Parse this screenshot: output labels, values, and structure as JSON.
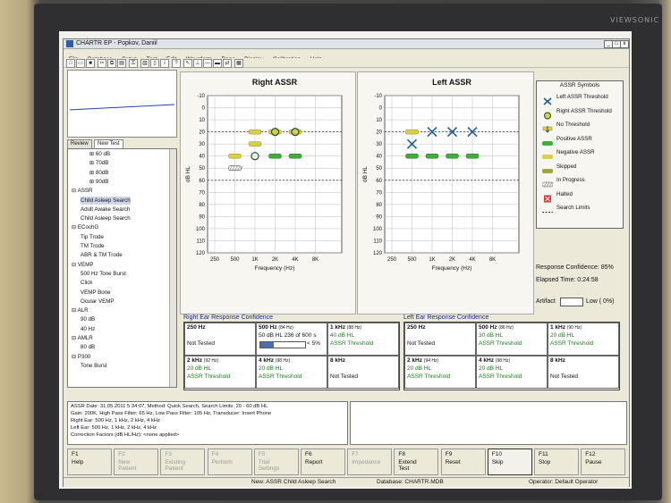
{
  "monitor": {
    "brand": "VIEWSONIC"
  },
  "window": {
    "title": "CHARTR EP - Popkov, Daniil",
    "buttons": [
      "_",
      "□",
      "x"
    ]
  },
  "menu": [
    "File",
    "Database",
    "Setup",
    "Test",
    "Edit",
    "Waveform",
    "Page",
    "Display",
    "Calibration",
    "Help"
  ],
  "left_panel": {
    "tabs": [
      "Review",
      "New Test"
    ],
    "tree": [
      {
        "label": "60 dB",
        "indent": 2,
        "expander": "+"
      },
      {
        "label": "70dB",
        "indent": 2,
        "expander": "+"
      },
      {
        "label": "80dB",
        "indent": 2,
        "expander": "+"
      },
      {
        "label": "90dB",
        "indent": 2,
        "expander": "+"
      },
      {
        "label": "ASSR",
        "indent": 0,
        "expander": "-"
      },
      {
        "label": "Child Asleep Search",
        "indent": 1,
        "expander": "",
        "selected": true
      },
      {
        "label": "Adult Awake Search",
        "indent": 1,
        "expander": ""
      },
      {
        "label": "Child Asleep Search",
        "indent": 1,
        "expander": ""
      },
      {
        "label": "ECochG",
        "indent": 0,
        "expander": "-"
      },
      {
        "label": "Tip Trode",
        "indent": 1,
        "expander": ""
      },
      {
        "label": "TM Trode",
        "indent": 1,
        "expander": ""
      },
      {
        "label": "ABR & TM Trode",
        "indent": 1,
        "expander": ""
      },
      {
        "label": "VEMP",
        "indent": 0,
        "expander": "-"
      },
      {
        "label": "500 Hz Tone Burst",
        "indent": 1,
        "expander": ""
      },
      {
        "label": "Click",
        "indent": 1,
        "expander": ""
      },
      {
        "label": "VEMP Bone",
        "indent": 1,
        "expander": ""
      },
      {
        "label": "Ocular VEMP",
        "indent": 1,
        "expander": ""
      },
      {
        "label": "ALR",
        "indent": 0,
        "expander": "-"
      },
      {
        "label": "90 dB",
        "indent": 1,
        "expander": ""
      },
      {
        "label": "40 Hz",
        "indent": 1,
        "expander": ""
      },
      {
        "label": "AMLR",
        "indent": 0,
        "expander": "-"
      },
      {
        "label": "80 dB",
        "indent": 1,
        "expander": ""
      },
      {
        "label": "P300",
        "indent": 0,
        "expander": "-"
      },
      {
        "label": "Tone Burst",
        "indent": 1,
        "expander": ""
      }
    ]
  },
  "chart_data": [
    {
      "type": "scatter",
      "title": "Right ASSR",
      "xlabel": "Frequency (Hz)",
      "ylabel": "dB HL",
      "x_ticks": [
        "250",
        "500",
        "1K",
        "2K",
        "4K",
        "8K"
      ],
      "y_ticks": [
        -10,
        0,
        10,
        20,
        30,
        40,
        50,
        60,
        70,
        80,
        90,
        100,
        110,
        120
      ],
      "ylim": [
        -10,
        120
      ],
      "search_limits": [
        20,
        60
      ],
      "series": [
        {
          "name": "Right ASSR Threshold",
          "points": [
            {
              "x": "1K",
              "y": 40
            },
            {
              "x": "2K",
              "y": 20
            },
            {
              "x": "4K",
              "y": 20
            }
          ]
        },
        {
          "name": "Positive ASSR",
          "points": [
            {
              "x": "2K",
              "y": 40
            },
            {
              "x": "4K",
              "y": 40
            }
          ]
        },
        {
          "name": "Negative ASSR",
          "points": [
            {
              "x": "500",
              "y": 40
            },
            {
              "x": "1K",
              "y": 20
            },
            {
              "x": "1K",
              "y": 30
            },
            {
              "x": "2K",
              "y": 20
            },
            {
              "x": "4K",
              "y": 20
            }
          ]
        },
        {
          "name": "In Progress",
          "points": [
            {
              "x": "500",
              "y": 50
            }
          ]
        }
      ]
    },
    {
      "type": "scatter",
      "title": "Left ASSR",
      "xlabel": "Frequency (Hz)",
      "ylabel": "dB HL",
      "x_ticks": [
        "250",
        "500",
        "1K",
        "2K",
        "4K",
        "8K"
      ],
      "y_ticks": [
        -10,
        0,
        10,
        20,
        30,
        40,
        50,
        60,
        70,
        80,
        90,
        100,
        110,
        120
      ],
      "ylim": [
        -10,
        120
      ],
      "search_limits": [
        20,
        60
      ],
      "series": [
        {
          "name": "Left ASSR Threshold",
          "points": [
            {
              "x": "500",
              "y": 30
            },
            {
              "x": "1K",
              "y": 20
            },
            {
              "x": "2K",
              "y": 20
            },
            {
              "x": "4K",
              "y": 20
            }
          ]
        },
        {
          "name": "Positive ASSR",
          "points": [
            {
              "x": "500",
              "y": 40
            },
            {
              "x": "1K",
              "y": 40
            },
            {
              "x": "2K",
              "y": 40
            },
            {
              "x": "4K",
              "y": 40
            }
          ]
        },
        {
          "name": "Negative ASSR",
          "points": [
            {
              "x": "500",
              "y": 20
            }
          ]
        }
      ]
    }
  ],
  "legend": {
    "title": "ASSR Symbols",
    "items": [
      {
        "label": "Left ASSR Threshold",
        "symbol": "x-icon"
      },
      {
        "label": "Right ASSR Threshold",
        "symbol": "circle-icon"
      },
      {
        "label": "No Threshold",
        "symbol": "arrow-icon"
      },
      {
        "label": "Positive ASSR",
        "symbol": "green-bar"
      },
      {
        "label": "Negative ASSR",
        "symbol": "yellow-bar"
      },
      {
        "label": "Skipped",
        "symbol": "olive-bar"
      },
      {
        "label": "In Progress",
        "symbol": "hatched-bar"
      },
      {
        "label": "Halted",
        "symbol": "red-x-box"
      },
      {
        "label": "Search Limits",
        "symbol": "dashed-line"
      }
    ]
  },
  "status_info": {
    "response_confidence": "Response Confidence: 85%",
    "elapsed_time": "Elapsed Time: 0:24:58",
    "artifact_label": "Artifact",
    "artifact_value": "Low ( 0%)"
  },
  "right_conf": {
    "title": "Right Ear Response Confidence",
    "cells": [
      {
        "freq": "250 Hz",
        "sub": "",
        "lines": [
          "",
          "Not Tested"
        ],
        "green": false
      },
      {
        "freq": "500 Hz",
        "sub": "(84 Hz)",
        "lines": [
          "50 dB HL 236 of 600 s",
          "< 5%"
        ],
        "green": false,
        "progress": 0.3
      },
      {
        "freq": "1 kHz",
        "sub": "(88 Hz)",
        "lines": [
          "40 dB HL",
          "ASSR Threshold"
        ],
        "green": true
      },
      {
        "freq": "2 kHz",
        "sub": "(92 Hz)",
        "lines": [
          "20 dB HL",
          "ASSR Threshold"
        ],
        "green": true
      },
      {
        "freq": "4 kHz",
        "sub": "(98 Hz)",
        "lines": [
          "20 dB HL",
          "ASSR Threshold"
        ],
        "green": true
      },
      {
        "freq": "8 kHz",
        "sub": "",
        "lines": [
          "",
          "Not Tested"
        ],
        "green": false
      }
    ]
  },
  "left_conf": {
    "title": "Left Ear Response Confidence",
    "cells": [
      {
        "freq": "250 Hz",
        "sub": "",
        "lines": [
          "",
          "Not Tested"
        ],
        "green": false
      },
      {
        "freq": "500 Hz",
        "sub": "(86 Hz)",
        "lines": [
          "30 dB HL",
          "ASSR Threshold"
        ],
        "green": true
      },
      {
        "freq": "1 kHz",
        "sub": "(90 Hz)",
        "lines": [
          "20 dB HL",
          "ASSR Threshold"
        ],
        "green": true
      },
      {
        "freq": "2 kHz",
        "sub": "(94 Hz)",
        "lines": [
          "20 dB HL",
          "ASSR Threshold"
        ],
        "green": true
      },
      {
        "freq": "4 kHz",
        "sub": "(98 Hz)",
        "lines": [
          "20 dB HL",
          "ASSR Threshold"
        ],
        "green": true
      },
      {
        "freq": "8 kHz",
        "sub": "",
        "lines": [
          "",
          "Not Tested"
        ],
        "green": false
      }
    ]
  },
  "notes": [
    "ASSR Date: 31.05.2011 5:34:07, Method: Quick Search, Search Limits: 20 - 60 dB HL",
    "Gain: 200K, High Pass Filter: 65 Hz, Low Pass Filter: 105 Hz, Transducer: Insert Phone",
    "Right Ear: 500 Hz, 1 kHz, 2 kHz, 4 kHz",
    "Left Ear: 500 Hz, 1 kHz, 2 kHz, 4 kHz",
    "Correction Factors (dB HL/Hz): <none applied>"
  ],
  "function_keys": [
    {
      "key": "F1",
      "label": "Help",
      "enabled": true
    },
    {
      "key": "F2",
      "label": "New\nPatient",
      "enabled": false
    },
    {
      "key": "F3",
      "label": "Existing\nPatient",
      "enabled": false
    },
    {
      "key": "F4",
      "label": "Perform",
      "enabled": false
    },
    {
      "key": "F5",
      "label": "Trial\nSettings",
      "enabled": false
    },
    {
      "key": "F6",
      "label": "Report",
      "enabled": true
    },
    {
      "key": "F7",
      "label": "Impedance",
      "enabled": false
    },
    {
      "key": "F8",
      "label": "Extend\nTest",
      "enabled": true
    },
    {
      "key": "F9",
      "label": "Reset",
      "enabled": true
    },
    {
      "key": "F10",
      "label": "Skip",
      "enabled": true
    },
    {
      "key": "F11",
      "label": "Stop",
      "enabled": true
    },
    {
      "key": "F12",
      "label": "Pause",
      "enabled": true
    }
  ],
  "statusbar": {
    "test": "New: ASSR Child Asleep Search",
    "database": "Database: CHARTR.MDB",
    "operator": "Operator: Default Operator"
  },
  "colors": {
    "positive": "#3fae3a",
    "negative": "#d8cf4a",
    "threshold": "#2f7d3c",
    "search_line": "#333333"
  }
}
